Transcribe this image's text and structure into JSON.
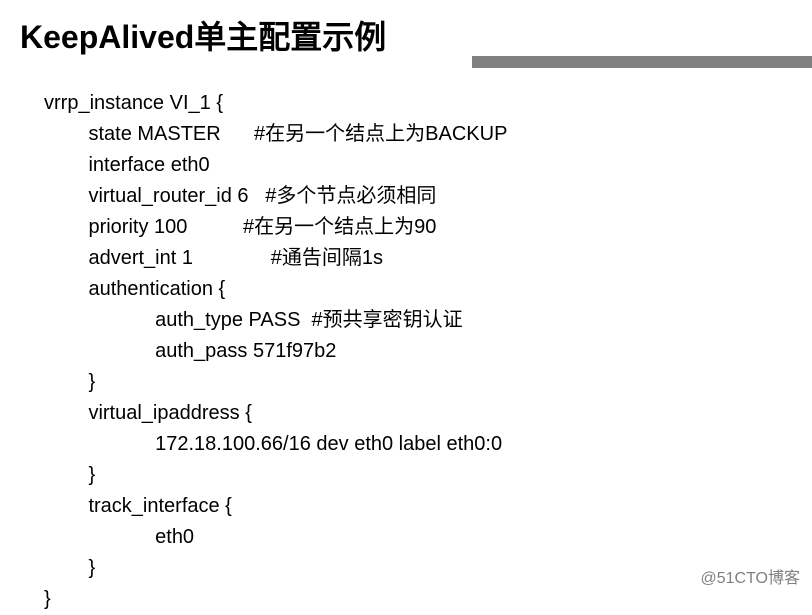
{
  "title": "KeepAlived单主配置示例",
  "config": {
    "lines": [
      "vrrp_instance VI_1 {",
      "        state MASTER      #在另一个结点上为BACKUP",
      "        interface eth0",
      "        virtual_router_id 6   #多个节点必须相同",
      "        priority 100          #在另一个结点上为90",
      "        advert_int 1              #通告间隔1s",
      "        authentication {",
      "                    auth_type PASS  #预共享密钥认证",
      "                    auth_pass 571f97b2",
      "        }",
      "        virtual_ipaddress {",
      "                    172.18.100.66/16 dev eth0 label eth0:0",
      "        }",
      "        track_interface {",
      "                    eth0",
      "        }",
      "}"
    ]
  },
  "watermark": "@51CTO博客"
}
